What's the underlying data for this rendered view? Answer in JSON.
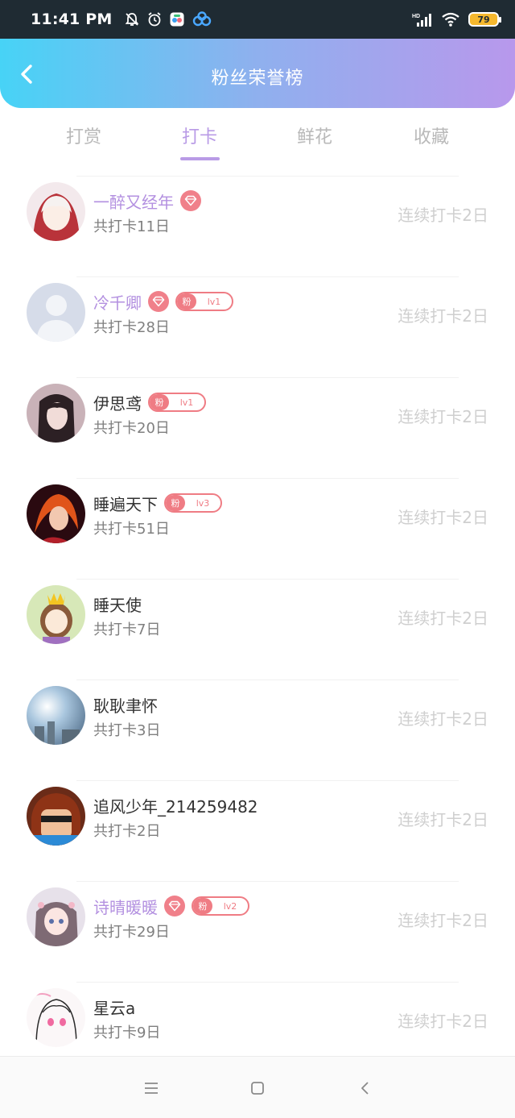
{
  "status_bar": {
    "time": "11:41 PM",
    "battery": "79",
    "icons": [
      "bell-off-icon",
      "alarm-icon",
      "app-icon",
      "cloud-icon",
      "signal-icon",
      "wifi-icon"
    ]
  },
  "header": {
    "title": "粉丝荣誉榜",
    "back_icon": "chevron-left-icon"
  },
  "tabs": [
    {
      "label": "打赏",
      "active": false
    },
    {
      "label": "打卡",
      "active": true
    },
    {
      "label": "鲜花",
      "active": false
    },
    {
      "label": "收藏",
      "active": false
    }
  ],
  "users": [
    {
      "name": "一醉又经年",
      "vip": true,
      "diamond": true,
      "fan_badge": null,
      "total": "共打卡11日",
      "streak": "连续打卡2日"
    },
    {
      "name": "冷千卿",
      "vip": true,
      "diamond": true,
      "fan_badge": {
        "fan": "粉",
        "level": "lv1"
      },
      "total": "共打卡28日",
      "streak": "连续打卡2日"
    },
    {
      "name": "伊思鸢",
      "vip": false,
      "diamond": false,
      "fan_badge": {
        "fan": "粉",
        "level": "lv1"
      },
      "total": "共打卡20日",
      "streak": "连续打卡2日"
    },
    {
      "name": "睡遍天下",
      "vip": false,
      "diamond": false,
      "fan_badge": {
        "fan": "粉",
        "level": "lv3"
      },
      "total": "共打卡51日",
      "streak": "连续打卡2日"
    },
    {
      "name": "睡天使",
      "vip": false,
      "diamond": false,
      "fan_badge": null,
      "total": "共打卡7日",
      "streak": "连续打卡2日"
    },
    {
      "name": "耿耿聿怀",
      "vip": false,
      "diamond": false,
      "fan_badge": null,
      "total": "共打卡3日",
      "streak": "连续打卡2日"
    },
    {
      "name": "追风少年_214259482",
      "vip": false,
      "diamond": false,
      "fan_badge": null,
      "total": "共打卡2日",
      "streak": "连续打卡2日"
    },
    {
      "name": "诗晴暖暖",
      "vip": true,
      "diamond": true,
      "fan_badge": {
        "fan": "粉",
        "level": "lv2"
      },
      "total": "共打卡29日",
      "streak": "连续打卡2日"
    },
    {
      "name": "星云a",
      "vip": false,
      "diamond": false,
      "fan_badge": null,
      "total": "共打卡9日",
      "streak": "连续打卡2日"
    }
  ],
  "colors": {
    "header_start": "#47d3f6",
    "header_end": "#b898ec",
    "accent": "#b99be6",
    "vip_name": "#b390e0",
    "badge": "#ef7c84"
  },
  "nav_bar": [
    "menu-icon",
    "home-square-icon",
    "back-triangle-icon"
  ]
}
